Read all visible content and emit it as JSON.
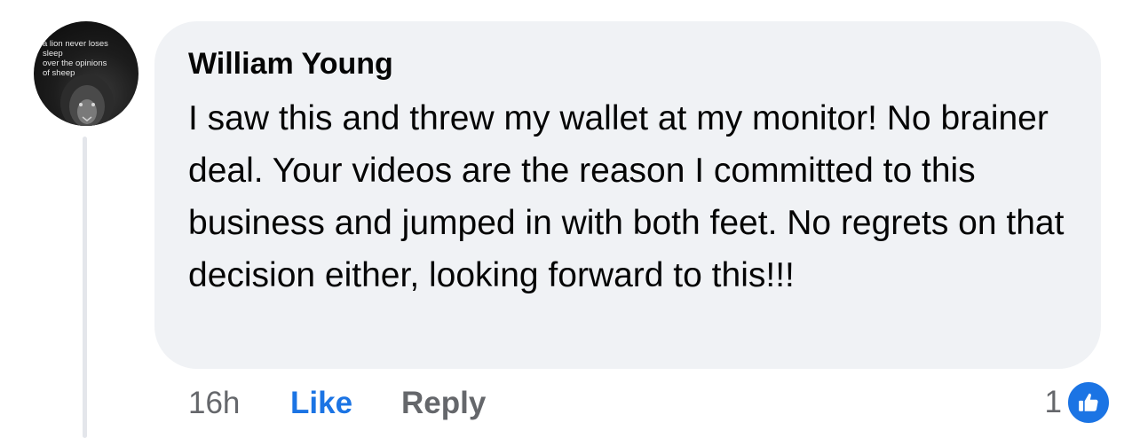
{
  "avatar": {
    "caption": "a lion never loses\nsleep\nover the opinions\nof sheep"
  },
  "comment": {
    "author": "William Young",
    "text": "I saw this and threw my wallet at my monitor! No brainer deal. Your videos are the reason I committed to this business and jumped in with both feet. No regrets on that decision either, looking forward to this!!!",
    "timestamp": "16h",
    "like_label": "Like",
    "reply_label": "Reply",
    "reaction_count": "1",
    "reaction_icon": "thumbs-up-icon"
  },
  "colors": {
    "bubble": "#f0f2f5",
    "like_blue": "#1b74e4",
    "secondary_text": "#65676b",
    "primary_text": "#050505"
  }
}
